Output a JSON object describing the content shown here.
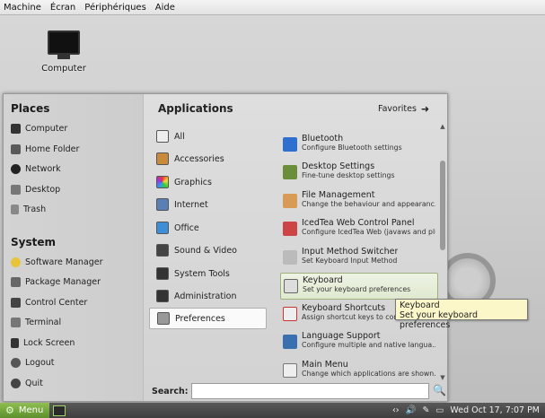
{
  "vm_menu": [
    "Machine",
    "Écran",
    "Périphériques",
    "Aide"
  ],
  "desktop": {
    "computer_label": "Computer"
  },
  "places": {
    "title": "Places",
    "items": [
      "Computer",
      "Home Folder",
      "Network",
      "Desktop",
      "Trash"
    ]
  },
  "system": {
    "title": "System",
    "items": [
      "Software Manager",
      "Package Manager",
      "Control Center",
      "Terminal",
      "Lock Screen",
      "Logout",
      "Quit"
    ]
  },
  "applications": {
    "title": "Applications",
    "favorites_label": "Favorites",
    "categories": [
      "All",
      "Accessories",
      "Graphics",
      "Internet",
      "Office",
      "Sound & Video",
      "System Tools",
      "Administration",
      "Preferences"
    ],
    "selected_category": "Preferences",
    "apps": [
      {
        "name": "Bluetooth",
        "desc": "Configure Bluetooth settings"
      },
      {
        "name": "Desktop Settings",
        "desc": "Fine-tune desktop settings"
      },
      {
        "name": "File Management",
        "desc": "Change the behaviour and appearanc..."
      },
      {
        "name": "IcedTea Web Control Panel",
        "desc": "Configure IcedTea Web (javaws and plu..."
      },
      {
        "name": "Input Method Switcher",
        "desc": "Set Keyboard Input Method"
      },
      {
        "name": "Keyboard",
        "desc": "Set your keyboard preferences"
      },
      {
        "name": "Keyboard Shortcuts",
        "desc": "Assign shortcut keys to comm..."
      },
      {
        "name": "Language Support",
        "desc": "Configure multiple and native langua..."
      },
      {
        "name": "Main Menu",
        "desc": "Change which applications are shown..."
      }
    ]
  },
  "search": {
    "label": "Search:",
    "value": ""
  },
  "tooltip": {
    "line1": "Keyboard",
    "line2": "Set your keyboard preferences"
  },
  "taskbar": {
    "menu_label": "Menu",
    "clock": "Wed Oct 17,  7:07 PM"
  },
  "colors": {
    "menu_green": "#6fa23a",
    "tooltip_bg": "#fcf7c9",
    "hover": "#dfe9cf"
  }
}
